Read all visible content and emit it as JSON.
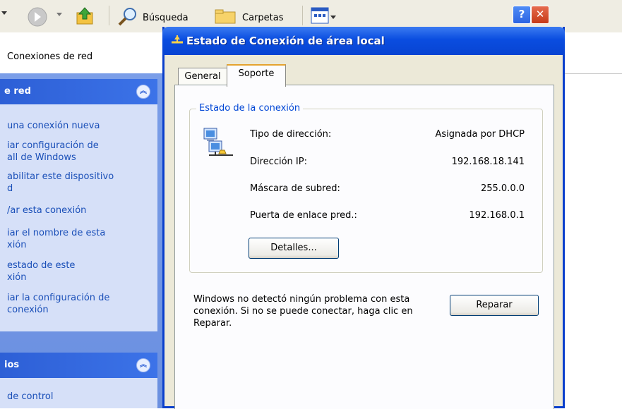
{
  "toolbar": {
    "search_label": "Búsqueda",
    "folders_label": "Carpetas"
  },
  "address": {
    "text": "Conexiones de red"
  },
  "left_pane": {
    "network_panel": {
      "title": "e red",
      "tasks": [
        "una conexión nueva",
        "iar configuración de\nall de Windows",
        "abilitar este dispositivo\nd",
        "/ar esta conexión",
        "iar el nombre de esta\nxión",
        "estado de este\nxión",
        "iar la configuración de\nconexión"
      ]
    },
    "other_panel": {
      "title": "ios",
      "tasks": [
        "de control"
      ]
    }
  },
  "dialog": {
    "title": "Estado de Conexión de área local",
    "help_label": "?",
    "close_label": "✕",
    "tabs": [
      "General",
      "Soporte"
    ],
    "active_tab": "Soporte",
    "group_title": "Estado de la conexión",
    "rows": [
      {
        "label": "Tipo de dirección:",
        "value": "Asignada por DHCP"
      },
      {
        "label": "Dirección IP:",
        "value": "192.168.18.141"
      },
      {
        "label": "Máscara de subred:",
        "value": "255.0.0.0"
      },
      {
        "label": "Puerta de enlace pred.:",
        "value": "192.168.0.1"
      }
    ],
    "details_button": "Detalles...",
    "message": "Windows no detectó ningún problema con esta conexión. Si no se puede conectar, haga clic en Reparar.",
    "repair_button": "Reparar"
  },
  "colors": {
    "title_bar": "#0a4de0",
    "task_link": "#1a4fb8",
    "group_title": "#0046d5",
    "active_tab_accent": "#e5a32f"
  }
}
